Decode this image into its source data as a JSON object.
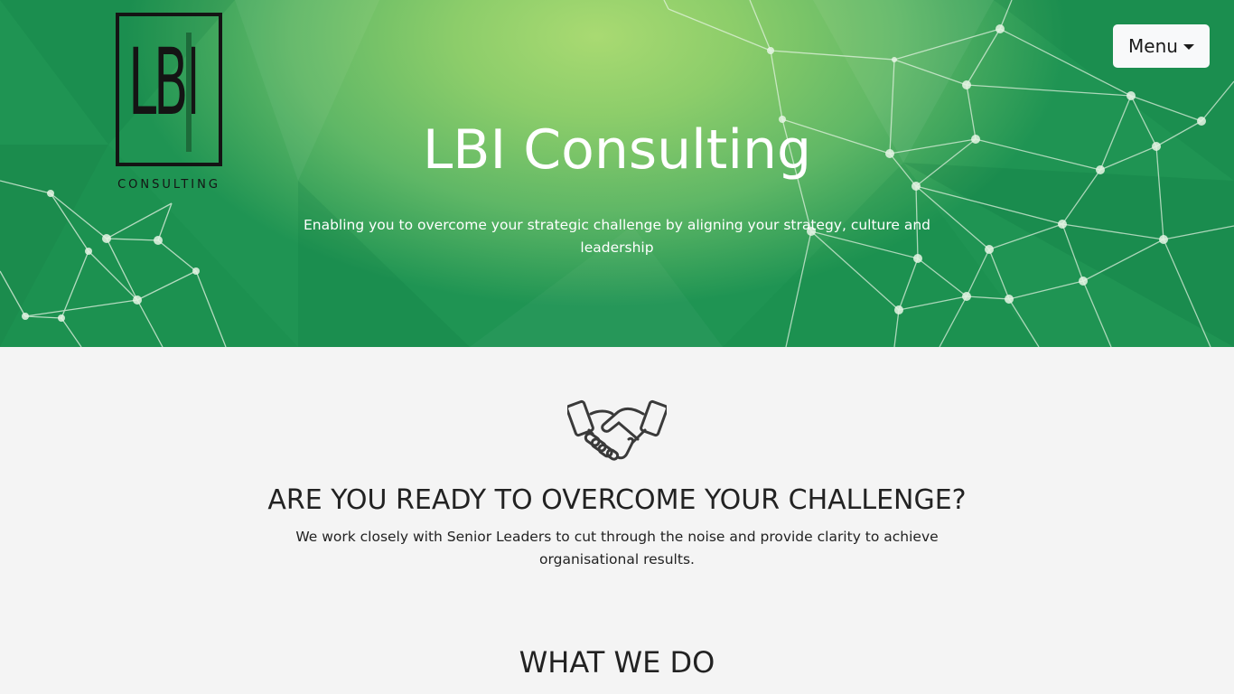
{
  "header": {
    "logo": {
      "letters": "LBI",
      "caption": "CONSULTING"
    },
    "menu_button": {
      "label": "Menu",
      "icon": "caret-down-icon"
    }
  },
  "hero": {
    "title": "LBI Consulting",
    "subtitle": "Enabling you to overcome your strategic challenge by aligning your strategy, culture and leadership",
    "colors": {
      "accent_light": "#a9da72",
      "accent_dark": "#1f9453"
    }
  },
  "challenge_section": {
    "icon": "handshake-icon",
    "heading": "ARE YOU READY TO OVERCOME YOUR CHALLENGE?",
    "text": "We work closely with Senior Leaders to cut through the noise and provide clarity to achieve organisational results."
  },
  "what_we_do_section": {
    "heading": "WHAT WE DO"
  }
}
